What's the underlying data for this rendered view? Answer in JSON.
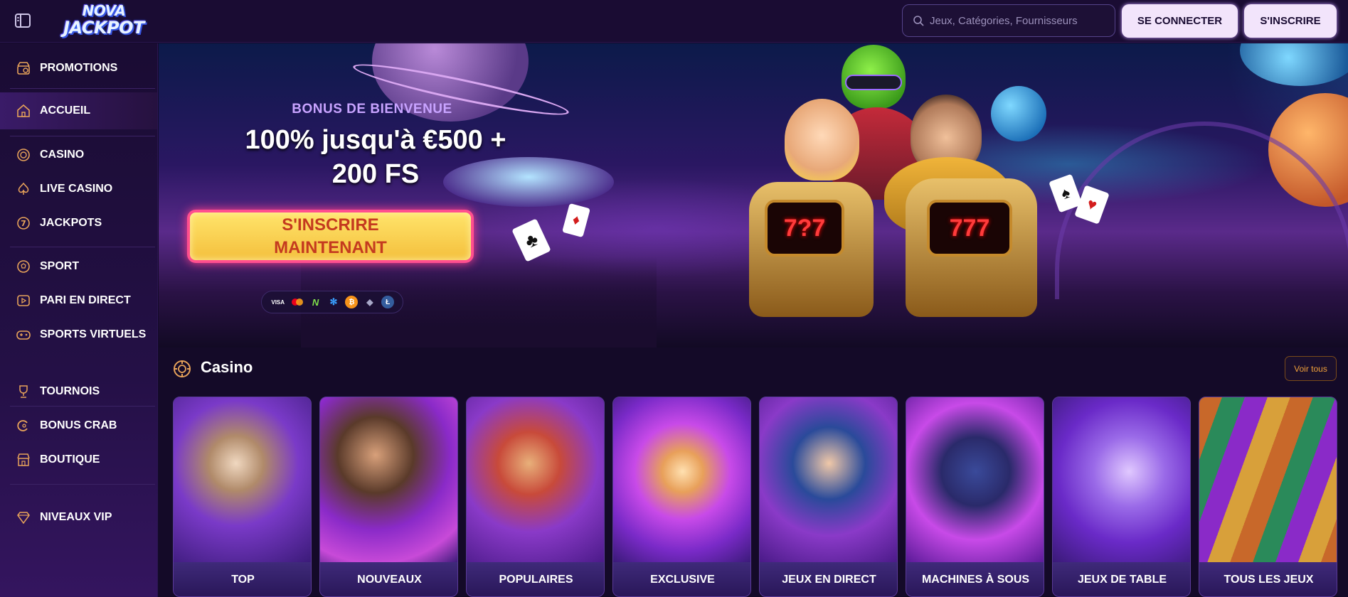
{
  "header": {
    "logo_line1": "NOVA",
    "logo_line2": "JACKPOT",
    "search_placeholder": "Jeux, Catégories, Fournisseurs",
    "login_label": "SE CONNECTER",
    "signup_label": "S'INSCRIRE"
  },
  "sidebar": {
    "items": [
      {
        "label": "PROMOTIONS",
        "icon": "gift-shop-icon"
      },
      {
        "label": "ACCUEIL",
        "icon": "home-icon"
      },
      {
        "label": "CASINO",
        "icon": "casino-chip-icon"
      },
      {
        "label": "LIVE CASINO",
        "icon": "spade-icon"
      },
      {
        "label": "JACKPOTS",
        "icon": "seven-icon"
      },
      {
        "label": "SPORT",
        "icon": "football-icon"
      },
      {
        "label": "PARI EN DIRECT",
        "icon": "play-icon"
      },
      {
        "label": "SPORTS VIRTUELS",
        "icon": "gamepad-icon"
      },
      {
        "label": "TOURNOIS",
        "icon": "trophy-icon"
      },
      {
        "label": "BONUS CRAB",
        "icon": "crab-icon"
      },
      {
        "label": "BOUTIQUE",
        "icon": "store-icon"
      },
      {
        "label": "NIVEAUX VIP",
        "icon": "diamond-icon"
      }
    ]
  },
  "hero": {
    "welcome_title": "BONUS DE BIENVENUE",
    "bonus_line1": "100% jusqu'à €500 +",
    "bonus_line2": "200 FS",
    "cta_line1": "S'INSCRIRE",
    "cta_line2": "MAINTENANT",
    "payments": [
      "VISA",
      "mastercard",
      "N",
      "ripple",
      "bitcoin",
      "ethereum",
      "litecoin"
    ],
    "slot_left": "7?7",
    "slot_right": "777"
  },
  "casino": {
    "title": "Casino",
    "see_all": "Voir tous",
    "tiles": [
      {
        "label": "TOP"
      },
      {
        "label": "NOUVEAUX"
      },
      {
        "label": "POPULAIRES"
      },
      {
        "label": "EXCLUSIVE"
      },
      {
        "label": "JEUX EN DIRECT"
      },
      {
        "label": "MACHINES À SOUS"
      },
      {
        "label": "JEUX DE TABLE"
      },
      {
        "label": "TOUS LES JEUX"
      }
    ]
  },
  "colors": {
    "background": "#140a2a",
    "accent_orange": "#e8a35a",
    "cta_yellow": "#ffe46b",
    "cta_border": "#ff4f8f",
    "button_light": "#f2e4fb"
  }
}
